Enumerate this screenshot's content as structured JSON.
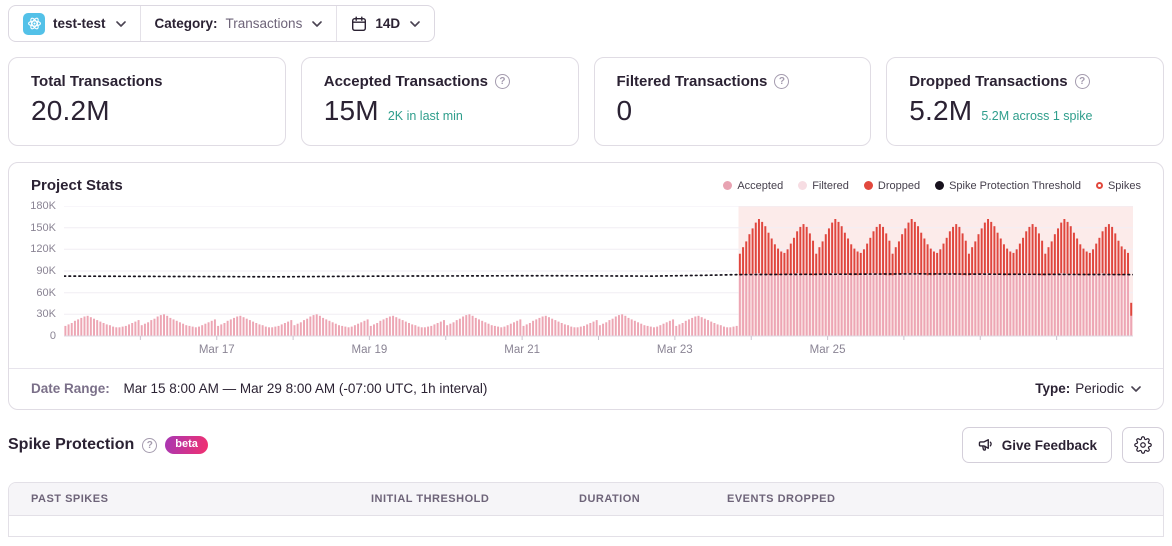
{
  "header": {
    "project": {
      "name": "test-test",
      "platform_icon": "react-atom"
    },
    "category": {
      "label": "Category:",
      "value": "Transactions"
    },
    "period": {
      "label": "14D",
      "icon": "calendar"
    }
  },
  "icons": {
    "project_platform": "react-atom-icon",
    "date_picker": "calendar-icon",
    "help": "question-circle-icon",
    "chevron": "chevron-down-icon",
    "feedback": "megaphone-icon",
    "settings": "gear-icon"
  },
  "stat_cards": [
    {
      "title": "Total Transactions",
      "value": "20.2M",
      "subtext": "",
      "has_help": false
    },
    {
      "title": "Accepted Transactions",
      "value": "15M",
      "subtext": "2K in last min",
      "has_help": true
    },
    {
      "title": "Filtered Transactions",
      "value": "0",
      "subtext": "",
      "has_help": true
    },
    {
      "title": "Dropped Transactions",
      "value": "5.2M",
      "subtext": "5.2M across 1 spike",
      "has_help": true
    }
  ],
  "chart": {
    "title": "Project Stats",
    "legend": [
      {
        "label": "Accepted",
        "swatch": "#e8a3b2",
        "style": "dot"
      },
      {
        "label": "Filtered",
        "swatch": "#f7dde3",
        "style": "dot"
      },
      {
        "label": "Dropped",
        "swatch": "#e2483d",
        "style": "dot"
      },
      {
        "label": "Spike Protection Threshold",
        "swatch": "#17121d",
        "style": "dot"
      },
      {
        "label": "Spikes",
        "swatch": "#e2483d",
        "style": "ring"
      }
    ]
  },
  "chart_data": {
    "type": "bar",
    "stacked": true,
    "unit": "K",
    "interval": "1h",
    "x_start": "Mar 15 8:00 AM",
    "x_end": "Mar 29 8:00 AM",
    "ylim": [
      0,
      180
    ],
    "y_tick_labels_top_down": [
      "180K",
      "150K",
      "120K",
      "90K",
      "60K",
      "30K",
      "0"
    ],
    "x_tick_labels": [
      "Mar 17",
      "Mar 19",
      "Mar 21",
      "Mar 23",
      "Mar 25"
    ],
    "x_tick_fracs": [
      0.1429,
      0.2857,
      0.4286,
      0.5714,
      0.7143
    ],
    "day_tick_count": 14,
    "grid": true,
    "legend_position": "top-right",
    "region_color": "#fcebea",
    "series": [
      {
        "name": "Accepted",
        "color": "#eda6b4",
        "values": [
          14,
          16,
          18,
          21,
          23,
          25,
          27,
          28,
          26,
          24,
          22,
          20,
          18,
          16,
          15,
          13,
          12,
          12,
          13,
          14,
          16,
          18,
          20,
          22,
          15,
          17,
          19,
          22,
          24,
          27,
          29,
          30,
          28,
          25,
          23,
          21,
          19,
          17,
          15,
          14,
          13,
          12,
          13,
          15,
          17,
          19,
          21,
          23,
          14,
          16,
          18,
          21,
          23,
          25,
          27,
          28,
          26,
          24,
          22,
          20,
          18,
          16,
          15,
          13,
          12,
          12,
          13,
          14,
          16,
          18,
          20,
          22,
          15,
          17,
          19,
          22,
          24,
          27,
          29,
          30,
          28,
          25,
          23,
          21,
          19,
          17,
          15,
          14,
          13,
          12,
          13,
          15,
          17,
          19,
          21,
          23,
          14,
          16,
          18,
          21,
          23,
          25,
          27,
          28,
          26,
          24,
          22,
          20,
          18,
          16,
          15,
          13,
          12,
          12,
          13,
          14,
          16,
          18,
          20,
          22,
          15,
          17,
          19,
          22,
          24,
          27,
          29,
          30,
          28,
          25,
          23,
          21,
          19,
          17,
          15,
          14,
          13,
          12,
          13,
          15,
          17,
          19,
          21,
          23,
          14,
          16,
          18,
          21,
          23,
          25,
          27,
          28,
          26,
          24,
          22,
          20,
          18,
          16,
          15,
          13,
          12,
          12,
          13,
          14,
          16,
          18,
          20,
          22,
          15,
          17,
          19,
          22,
          24,
          27,
          29,
          30,
          28,
          25,
          23,
          21,
          19,
          17,
          15,
          14,
          13,
          12,
          13,
          15,
          17,
          19,
          21,
          23,
          14,
          16,
          18,
          21,
          23,
          25,
          27,
          28,
          26,
          24,
          22,
          20,
          18,
          16,
          15,
          13,
          12,
          12,
          13,
          14,
          84,
          85,
          85,
          86,
          86,
          87,
          87,
          86,
          86,
          85,
          85,
          84,
          84,
          84,
          85,
          85,
          86,
          86,
          87,
          86,
          85,
          85,
          84,
          84,
          84,
          85,
          85,
          86,
          86,
          87,
          87,
          86,
          86,
          85,
          85,
          84,
          84,
          84,
          85,
          85,
          86,
          86,
          87,
          86,
          85,
          85,
          84,
          84,
          84,
          85,
          85,
          86,
          86,
          87,
          87,
          86,
          86,
          85,
          85,
          84,
          84,
          84,
          85,
          85,
          86,
          86,
          87,
          86,
          85,
          85,
          84,
          84,
          84,
          85,
          85,
          86,
          86,
          87,
          87,
          86,
          86,
          85,
          85,
          84,
          84,
          84,
          85,
          85,
          86,
          86,
          87,
          86,
          85,
          85,
          84,
          84,
          84,
          85,
          85,
          86,
          86,
          87,
          87,
          86,
          86,
          85,
          85,
          84,
          84,
          84,
          85,
          85,
          86,
          86,
          87,
          86,
          85,
          85,
          84,
          84,
          84,
          85,
          85,
          28
        ]
      },
      {
        "name": "Dropped",
        "color": "#e0463e",
        "start_index": 212,
        "values": [
          30,
          38,
          46,
          55,
          63,
          70,
          75,
          72,
          66,
          58,
          50,
          43,
          37,
          33,
          30,
          35,
          42,
          50,
          58,
          65,
          70,
          66,
          58,
          48,
          30,
          38,
          46,
          55,
          63,
          70,
          75,
          72,
          66,
          58,
          50,
          43,
          37,
          33,
          30,
          35,
          42,
          50,
          58,
          65,
          70,
          66,
          58,
          48,
          30,
          38,
          46,
          55,
          63,
          70,
          75,
          72,
          66,
          58,
          50,
          43,
          37,
          33,
          30,
          35,
          42,
          50,
          58,
          65,
          70,
          66,
          58,
          48,
          30,
          38,
          46,
          55,
          63,
          70,
          75,
          72,
          66,
          58,
          50,
          43,
          37,
          33,
          30,
          35,
          42,
          50,
          58,
          65,
          70,
          66,
          58,
          48,
          30,
          38,
          46,
          55,
          63,
          70,
          75,
          72,
          66,
          58,
          50,
          43,
          37,
          33,
          30,
          35,
          42,
          50,
          58,
          65,
          70,
          66,
          58,
          48,
          40,
          35,
          30,
          18
        ]
      },
      {
        "name": "Filtered",
        "color": "#f7dde3",
        "total_shown": "0"
      }
    ],
    "threshold_line": {
      "name": "Spike Protection Threshold",
      "color": "#17121d",
      "points": [
        [
          0,
          83
        ],
        [
          0.08,
          82.5
        ],
        [
          0.2,
          82
        ],
        [
          0.3,
          83
        ],
        [
          0.45,
          83.5
        ],
        [
          0.55,
          83
        ],
        [
          0.6,
          84
        ],
        [
          0.631,
          85
        ],
        [
          0.7,
          85.5
        ],
        [
          0.8,
          86
        ],
        [
          0.9,
          85.5
        ],
        [
          1,
          85
        ]
      ]
    },
    "spike_regions": [
      {
        "start_index": 212,
        "end_index": 336,
        "label": "1 spike"
      }
    ]
  },
  "footer": {
    "date_range_label": "Date Range:",
    "date_range_value": "Mar 15 8:00 AM — Mar 29 8:00 AM (-07:00 UTC, 1h interval)",
    "type_label": "Type:",
    "type_value": "Periodic"
  },
  "spike_protection": {
    "title": "Spike Protection",
    "beta_badge": "beta",
    "give_feedback_label": "Give Feedback"
  },
  "table": {
    "columns": [
      "Past Spikes",
      "Initial Threshold",
      "Duration",
      "Events Dropped"
    ]
  },
  "colors": {
    "accepted": "#eda6b4",
    "filtered": "#f7dde3",
    "dropped": "#e0463e",
    "threshold": "#17121d",
    "spike_region": "#fcebea",
    "teal_subtext": "#2f9e8c",
    "beta_gradient": [
      "#a737b4",
      "#f2306f"
    ]
  }
}
